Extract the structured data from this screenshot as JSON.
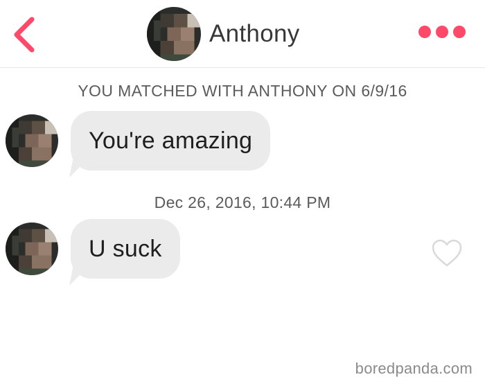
{
  "header": {
    "back_icon": "chevron-left-icon",
    "contact_name": "Anthony",
    "more_icon": "more-dots-icon",
    "accent_color": "#fd4a6a"
  },
  "conversation": {
    "match_notice": "YOU MATCHED WITH ANTHONY ON 6/9/16",
    "messages": [
      {
        "text": "You're amazing",
        "sender": "Anthony"
      },
      {
        "text": "U suck",
        "sender": "Anthony"
      }
    ],
    "timestamp": "Dec 26, 2016, 10:44 PM",
    "like_icon": "heart-outline-icon"
  },
  "watermark": "boredpanda.com"
}
